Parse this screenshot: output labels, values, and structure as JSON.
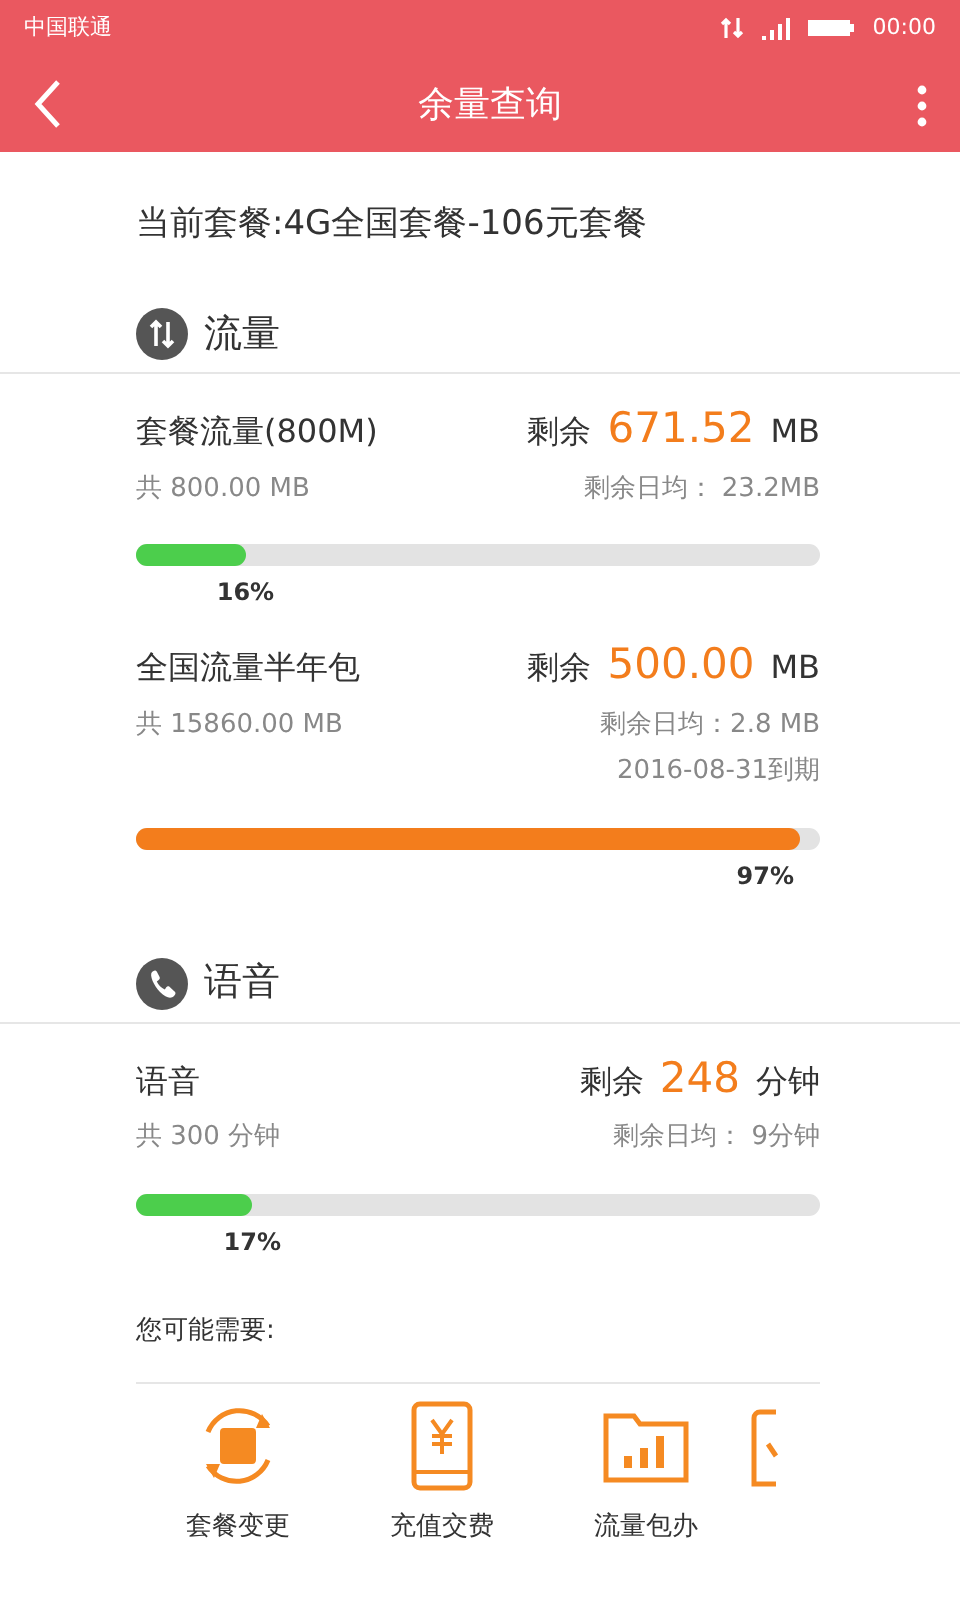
{
  "status_bar": {
    "carrier": "中国联通",
    "time": "00:00"
  },
  "header": {
    "title": "余量查询"
  },
  "plan": "当前套餐:4G全国套餐-106元套餐",
  "sections": [
    {
      "kind": "data",
      "title": "流量",
      "items": [
        {
          "name": "套餐流量(800M)",
          "remain_label": "剩余",
          "remain_value": "671.52",
          "unit": "MB",
          "total": "共 800.00 MB",
          "daily": "剩余日均： 23.2MB",
          "level": 0.16,
          "percent": "16%",
          "color": "#4cce4c"
        },
        {
          "name": "全国流量半年包",
          "remain_label": "剩余",
          "remain_value": "500.00",
          "unit": "MB",
          "total": "共 15860.00 MB",
          "daily": "剩余日均：2.8 MB",
          "expiry": "2016-08-31到期",
          "level": 0.97,
          "percent": "97%",
          "color": "#f37d1c"
        }
      ]
    },
    {
      "kind": "voice",
      "title": "语音",
      "items": [
        {
          "name": "语音",
          "remain_label": "剩余",
          "remain_value": "248",
          "unit": "分钟",
          "total": "共 300 分钟",
          "daily": "剩余日均： 9分钟",
          "level": 0.17,
          "percent": "17%",
          "color": "#4cce4c"
        }
      ]
    }
  ],
  "suggest": {
    "title": "您可能需要:",
    "shortcuts": [
      {
        "kind": "plan-change",
        "label": "套餐变更"
      },
      {
        "kind": "recharge",
        "label": "充值交费"
      },
      {
        "kind": "data-pack",
        "label": "流量包办"
      },
      {
        "kind": "partial"
      }
    ]
  }
}
